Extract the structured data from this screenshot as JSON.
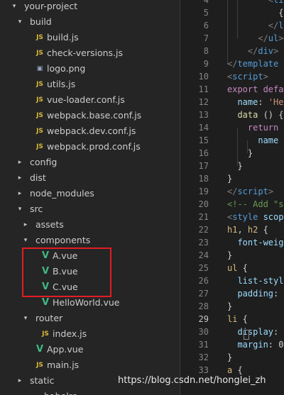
{
  "explorer": {
    "items": [
      {
        "label": "your-project",
        "kind": "folder",
        "expanded": true
      },
      {
        "label": "build",
        "kind": "folder",
        "expanded": true
      },
      {
        "label": "build.js",
        "kind": "js"
      },
      {
        "label": "check-versions.js",
        "kind": "js"
      },
      {
        "label": "logo.png",
        "kind": "png"
      },
      {
        "label": "utils.js",
        "kind": "js"
      },
      {
        "label": "vue-loader.conf.js",
        "kind": "js"
      },
      {
        "label": "webpack.base.conf.js",
        "kind": "js"
      },
      {
        "label": "webpack.dev.conf.js",
        "kind": "js"
      },
      {
        "label": "webpack.prod.conf.js",
        "kind": "js"
      },
      {
        "label": "config",
        "kind": "folder",
        "expanded": false
      },
      {
        "label": "dist",
        "kind": "folder",
        "expanded": false
      },
      {
        "label": "node_modules",
        "kind": "folder",
        "expanded": false
      },
      {
        "label": "src",
        "kind": "folder",
        "expanded": true
      },
      {
        "label": "assets",
        "kind": "folder",
        "expanded": false
      },
      {
        "label": "components",
        "kind": "folder",
        "expanded": true
      },
      {
        "label": "A.vue",
        "kind": "vue"
      },
      {
        "label": "B.vue",
        "kind": "vue"
      },
      {
        "label": "C.vue",
        "kind": "vue"
      },
      {
        "label": "HelloWorld.vue",
        "kind": "vue"
      },
      {
        "label": "router",
        "kind": "folder",
        "expanded": true
      },
      {
        "label": "index.js",
        "kind": "js"
      },
      {
        "label": "App.vue",
        "kind": "vue"
      },
      {
        "label": "main.js",
        "kind": "js"
      },
      {
        "label": "static",
        "kind": "folder",
        "expanded": false
      },
      {
        "label": ".babelrc",
        "kind": "file"
      }
    ],
    "icon_labels": {
      "js": "JS",
      "vue": "V",
      "png": "▣"
    }
  },
  "editor": {
    "line_numbers": [
      "4",
      "5",
      "6",
      "7",
      "8",
      "9",
      "10",
      "11",
      "12",
      "13",
      "14",
      "15",
      "16",
      "17",
      "18",
      "19",
      "20",
      "21",
      "22",
      "23",
      "24",
      "25",
      "26",
      "27",
      "28",
      "29",
      "30",
      "31",
      "32",
      "33"
    ],
    "active_line": "29",
    "lines": [
      [
        {
          "t": "        <",
          "c": "punct"
        },
        {
          "t": "li",
          "c": "tag"
        },
        {
          "t": ">",
          "c": "punct"
        }
      ],
      [
        {
          "t": "          {{",
          "c": "plain"
        },
        {
          "t": "i",
          "c": "prop"
        }
      ],
      [
        {
          "t": "        </",
          "c": "punct"
        },
        {
          "t": "li",
          "c": "tag"
        }
      ],
      [
        {
          "t": "      </",
          "c": "punct"
        },
        {
          "t": "ul",
          "c": "tag"
        },
        {
          "t": ">",
          "c": "punct"
        }
      ],
      [
        {
          "t": "    </",
          "c": "punct"
        },
        {
          "t": "div",
          "c": "tag"
        },
        {
          "t": ">",
          "c": "punct"
        }
      ],
      [
        {
          "t": "</",
          "c": "punct"
        },
        {
          "t": "template",
          "c": "tag"
        }
      ],
      [
        {
          "t": "<",
          "c": "punct"
        },
        {
          "t": "script",
          "c": "tag"
        },
        {
          "t": ">",
          "c": "punct"
        }
      ],
      [
        {
          "t": "export ",
          "c": "kw"
        },
        {
          "t": "defa",
          "c": "kw"
        }
      ],
      [
        {
          "t": "  name",
          "c": "prop"
        },
        {
          "t": ": ",
          "c": "plain"
        },
        {
          "t": "'He",
          "c": "str"
        }
      ],
      [
        {
          "t": "  data",
          "c": "fn"
        },
        {
          "t": " () ",
          "c": "plain"
        },
        {
          "t": "{",
          "c": "plain"
        }
      ],
      [
        {
          "t": "    return",
          "c": "kw"
        }
      ],
      [
        {
          "t": "      name",
          "c": "prop"
        }
      ],
      [
        {
          "t": "    }",
          "c": "plain"
        }
      ],
      [
        {
          "t": "  }",
          "c": "plain"
        }
      ],
      [
        {
          "t": "}",
          "c": "plain"
        }
      ],
      [
        {
          "t": "</",
          "c": "punct"
        },
        {
          "t": "script",
          "c": "tag"
        },
        {
          "t": ">",
          "c": "punct"
        }
      ],
      [
        {
          "t": "<!-- Add \"s",
          "c": "com"
        }
      ],
      [
        {
          "t": "<",
          "c": "punct"
        },
        {
          "t": "style",
          "c": "tag"
        },
        {
          "t": " scop",
          "c": "prop"
        }
      ],
      [
        {
          "t": "h1",
          "c": "sel"
        },
        {
          "t": ", ",
          "c": "plain"
        },
        {
          "t": "h2",
          "c": "sel"
        },
        {
          "t": " {",
          "c": "plain"
        }
      ],
      [
        {
          "t": "  font-weig",
          "c": "prop"
        }
      ],
      [
        {
          "t": "}",
          "c": "plain"
        }
      ],
      [
        {
          "t": "ul",
          "c": "sel"
        },
        {
          "t": " {",
          "c": "plain"
        }
      ],
      [
        {
          "t": "  list-styl",
          "c": "prop"
        }
      ],
      [
        {
          "t": "  padding",
          "c": "prop"
        },
        {
          "t": ":",
          "c": "plain"
        }
      ],
      [
        {
          "t": "}",
          "c": "plain"
        }
      ],
      [
        {
          "t": "li",
          "c": "sel"
        },
        {
          "t": " {",
          "c": "plain"
        }
      ],
      [
        {
          "t": "  display",
          "c": "prop"
        },
        {
          "t": ":",
          "c": "plain"
        }
      ],
      [
        {
          "t": "  margin",
          "c": "prop"
        },
        {
          "t": ": 0",
          "c": "plain"
        }
      ],
      [
        {
          "t": "}",
          "c": "plain"
        }
      ],
      [
        {
          "t": "a",
          "c": "sel"
        },
        {
          "t": " {",
          "c": "plain"
        }
      ]
    ]
  },
  "watermark": "https://blog.csdn.net/honglei_zh"
}
